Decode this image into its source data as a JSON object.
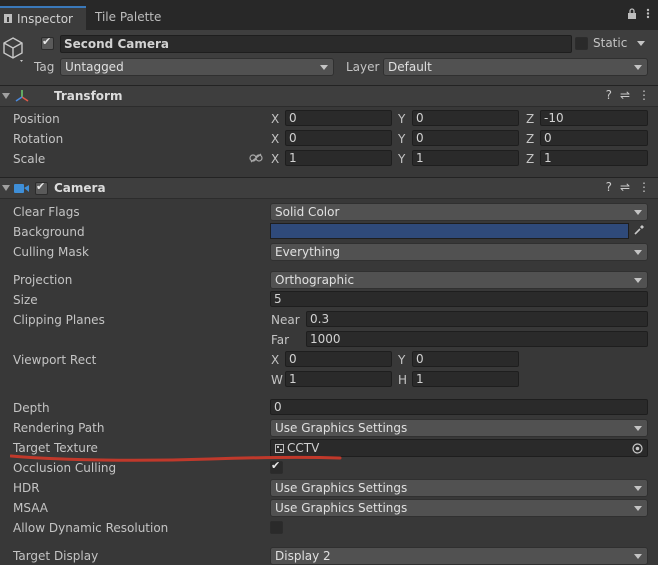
{
  "tabs": {
    "inspector": "Inspector",
    "tile_palette": "Tile Palette"
  },
  "object": {
    "name": "Second Camera",
    "static_label": "Static",
    "tag_label": "Tag",
    "tag_value": "Untagged",
    "layer_label": "Layer",
    "layer_value": "Default"
  },
  "transform": {
    "title": "Transform",
    "position_label": "Position",
    "rotation_label": "Rotation",
    "scale_label": "Scale",
    "x": "X",
    "y": "Y",
    "z": "Z",
    "position": {
      "x": "0",
      "y": "0",
      "z": "-10"
    },
    "rotation": {
      "x": "0",
      "y": "0",
      "z": "0"
    },
    "scale": {
      "x": "1",
      "y": "1",
      "z": "1"
    }
  },
  "camera": {
    "title": "Camera",
    "clear_flags_label": "Clear Flags",
    "clear_flags": "Solid Color",
    "background_label": "Background",
    "background_color": "#2f4a7a",
    "culling_mask_label": "Culling Mask",
    "culling_mask": "Everything",
    "projection_label": "Projection",
    "projection": "Orthographic",
    "size_label": "Size",
    "size": "5",
    "clipping_label": "Clipping Planes",
    "near_label": "Near",
    "near": "0.3",
    "far_label": "Far",
    "far": "1000",
    "viewport_label": "Viewport Rect",
    "vx_label": "X",
    "vy_label": "Y",
    "vw_label": "W",
    "vh_label": "H",
    "vx": "0",
    "vy": "0",
    "vw": "1",
    "vh": "1",
    "depth_label": "Depth",
    "depth": "0",
    "rendering_path_label": "Rendering Path",
    "rendering_path": "Use Graphics Settings",
    "target_texture_label": "Target Texture",
    "target_texture": "CCTV",
    "occlusion_label": "Occlusion Culling",
    "hdr_label": "HDR",
    "hdr": "Use Graphics Settings",
    "msaa_label": "MSAA",
    "msaa": "Use Graphics Settings",
    "dynres_label": "Allow Dynamic Resolution",
    "target_display_label": "Target Display",
    "target_display": "Display 2"
  },
  "annotation_color": "#c0392b"
}
